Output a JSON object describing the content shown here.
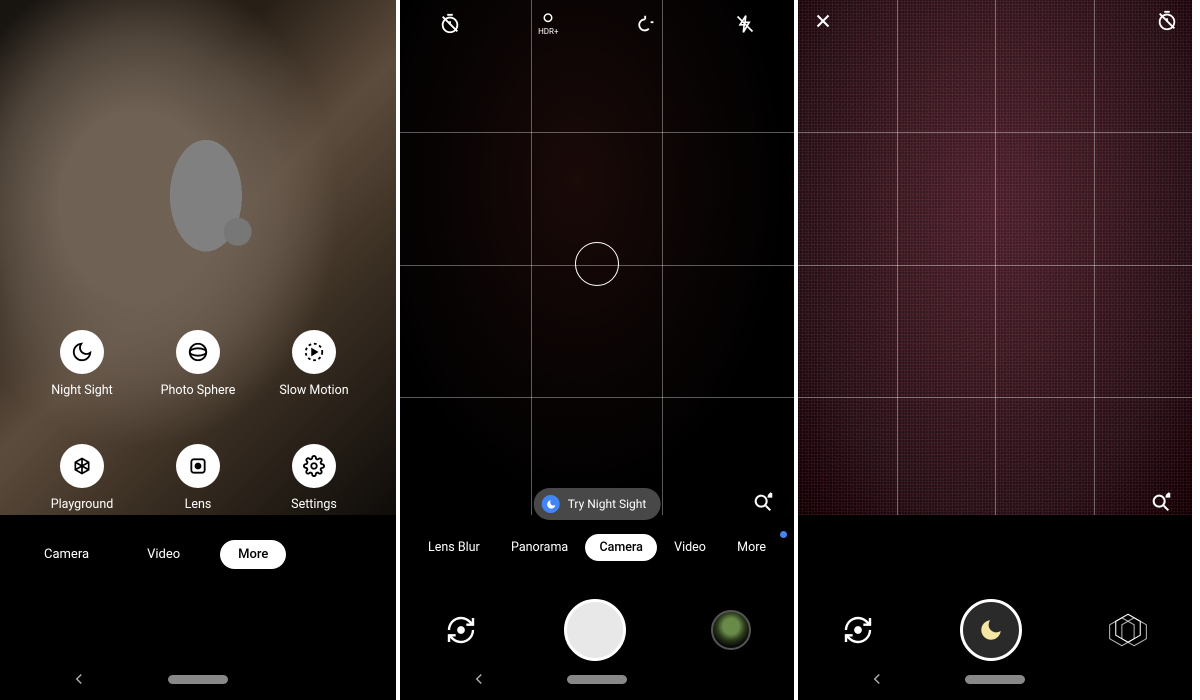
{
  "screen1": {
    "more_items": [
      {
        "label": "Night Sight",
        "icon": "moon"
      },
      {
        "label": "Photo Sphere",
        "icon": "sphere"
      },
      {
        "label": "Slow Motion",
        "icon": "slowmo"
      },
      {
        "label": "Playground",
        "icon": "playground"
      },
      {
        "label": "Lens",
        "icon": "lens"
      },
      {
        "label": "Settings",
        "icon": "gear"
      }
    ],
    "modes": {
      "camera": "Camera",
      "video": "Video",
      "more": "More"
    },
    "active_mode": "More"
  },
  "screen2": {
    "top_icons": {
      "timer_off": "timer-off",
      "hdr_label": "HDR+",
      "wb": "white-balance",
      "flash_off": "flash-off"
    },
    "chip_label": "Try Night Sight",
    "modes": {
      "lens_blur": "Lens Blur",
      "panorama": "Panorama",
      "camera": "Camera",
      "video": "Video",
      "more": "More"
    },
    "active_mode": "Camera",
    "more_has_badge": true
  },
  "screen3": {
    "mode_name": "Night Sight"
  }
}
